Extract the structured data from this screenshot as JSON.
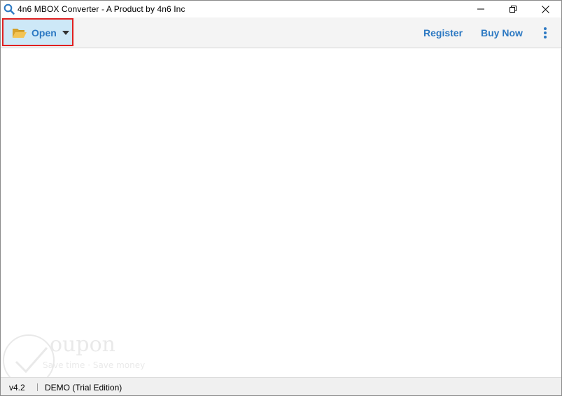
{
  "window": {
    "title": "4n6 MBOX Converter - A Product by 4n6 Inc",
    "app_icon": "search-icon",
    "controls": {
      "minimize_icon": "minimize-icon",
      "restore_icon": "restore-icon",
      "close_icon": "close-icon"
    }
  },
  "toolbar": {
    "open_label": "Open",
    "open_icon": "folder-open-icon",
    "open_dropdown_icon": "caret-down-icon",
    "register_label": "Register",
    "buy_now_label": "Buy Now",
    "more_icon": "kebab-menu-icon"
  },
  "watermark": {
    "word": "oupon",
    "tagline": "Save time · Save money"
  },
  "statusbar": {
    "version": "v4.2",
    "edition": "DEMO (Trial Edition)"
  },
  "colors": {
    "accent": "#2b78c2",
    "open_button_bg": "#cde8f7",
    "highlight_border": "#e02020",
    "toolbar_bg": "#f4f4f4",
    "statusbar_bg": "#f0f0f0"
  }
}
